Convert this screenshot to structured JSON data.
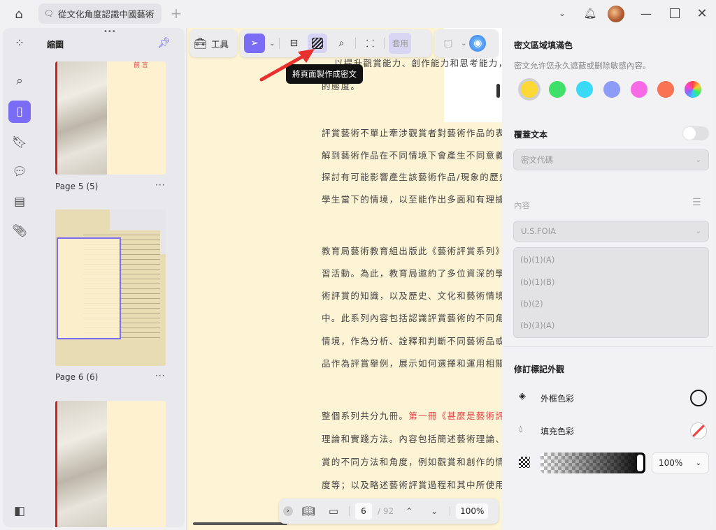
{
  "tab": {
    "title": "從文化角度認識中國藝術"
  },
  "thumbnails": {
    "title": "縮圖",
    "pages": [
      {
        "label": "Page 5 (5)",
        "heading": "前 言"
      },
      {
        "label": "Page 6 (6)"
      },
      {
        "label": ""
      }
    ]
  },
  "toolbar": {
    "tools_label": "工具",
    "apply_label": "套用",
    "tooltip": "將頁面製作成密文"
  },
  "document": {
    "top_lines": [
      "以提升觀賞能力、創作能力和思考能力，",
      "的態度。"
    ],
    "lines": [
      "評賞藝術不單止牽涉觀賞者對藝術作品的表象",
      "解到藝術作品在不同情境下會產生不同意義。",
      "探討有可能影響產生該藝術作品/現象的歷史情",
      "學生當下的情境，以至能作出多面和有理據的",
      "教育局藝術教育組出版此《藝術評賞系列》的",
      "習活動。為此，教育局邀約了多位資深的學者",
      "術評賞的知識，以及歷史、文化和藝術情境等",
      "中。此系列內容包括認識評賞藝術的不同角度",
      "情境，作為分析、詮釋和判斷不同藝術品或現",
      "品作為評賞舉例，展示如何選擇和運用相關材"
    ],
    "para3_start": "整個系列共分九冊。",
    "para3_red": "第一冊《甚麼是藝術評賞",
    "para3_lines": [
      "理論和實踐方法。內容包括簡述藝術理論、藝",
      "賞的不同方法和角度，例如觀賞和創作的情境",
      "度等；以及略述藝術評賞過程和其中所使用的"
    ]
  },
  "bottom": {
    "page": "6",
    "total": "/ 92",
    "zoom": "100%"
  },
  "panel": {
    "fill_title": "密文區域填滿色",
    "fill_desc": "密文允许您永久遮蔽或删除敏感內容。",
    "colors": [
      "#fcd934",
      "#3ee06a",
      "#3ad9f5",
      "#8d9cf7",
      "#f76ae6",
      "#fa7352",
      "rainbow"
    ],
    "selected_color": "#fcd934",
    "overlay_title": "覆蓋文本",
    "overlay_on": false,
    "code_placeholder": "密文代碼",
    "content_label": "內容",
    "content_select": "U.S.FOIA",
    "options": [
      "(b)(1)(A)",
      "(b)(1)(B)",
      "(b)(2)",
      "(b)(3)(A)"
    ],
    "appearance_title": "修訂標記外觀",
    "border_label": "外框色彩",
    "fill_label": "填充色彩",
    "opacity": "100%"
  }
}
